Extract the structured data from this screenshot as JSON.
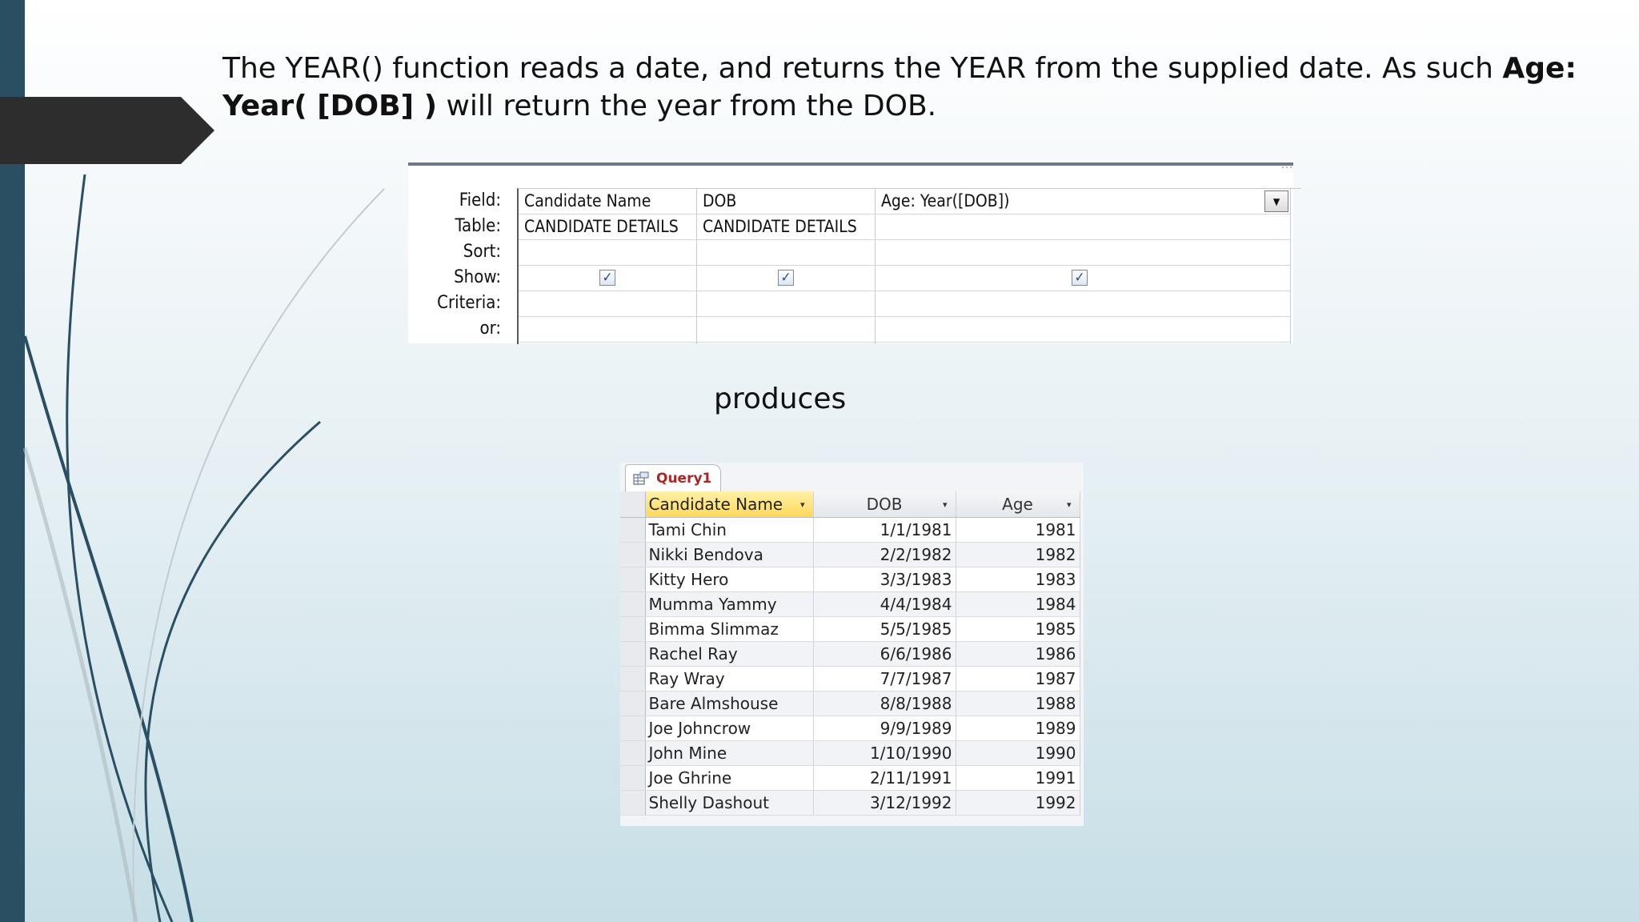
{
  "slide": {
    "intro_plain": "The YEAR() function reads a date, and returns the YEAR from the supplied date. As such ",
    "intro_bold": "Age: Year( [DOB] )",
    "intro_tail": " will return the year from the DOB.",
    "produces": "produces"
  },
  "qbe": {
    "row_labels": [
      "Field:",
      "Table:",
      "Sort:",
      "Show:",
      "Criteria:",
      "or:"
    ],
    "columns": [
      {
        "field": "Candidate Name",
        "table": "CANDIDATE DETAILS",
        "sort": "",
        "show": true
      },
      {
        "field": "DOB",
        "table": "CANDIDATE DETAILS",
        "sort": "",
        "show": true
      },
      {
        "field": "Age: Year([DOB])",
        "table": "",
        "sort": "",
        "show": true
      }
    ],
    "dots": "...",
    "checkmark": "✓",
    "dropdown_glyph": "▼"
  },
  "datasheet": {
    "tab_label": "Query1",
    "headers": [
      "Candidate Name",
      "DOB",
      "Age"
    ],
    "sort_glyph": "▾",
    "rows": [
      {
        "name": "Tami Chin",
        "dob": "1/1/1981",
        "age": "1981"
      },
      {
        "name": "Nikki Bendova",
        "dob": "2/2/1982",
        "age": "1982"
      },
      {
        "name": "Kitty Hero",
        "dob": "3/3/1983",
        "age": "1983"
      },
      {
        "name": "Mumma Yammy",
        "dob": "4/4/1984",
        "age": "1984"
      },
      {
        "name": "Bimma Slimmaz",
        "dob": "5/5/1985",
        "age": "1985"
      },
      {
        "name": "Rachel Ray",
        "dob": "6/6/1986",
        "age": "1986"
      },
      {
        "name": "Ray Wray",
        "dob": "7/7/1987",
        "age": "1987"
      },
      {
        "name": "Bare Almshouse",
        "dob": "8/8/1988",
        "age": "1988"
      },
      {
        "name": "Joe Johncrow",
        "dob": "9/9/1989",
        "age": "1989"
      },
      {
        "name": "John Mine",
        "dob": "1/10/1990",
        "age": "1990"
      },
      {
        "name": "Joe Ghrine",
        "dob": "2/11/1991",
        "age": "1991"
      },
      {
        "name": "Shelly Dashout",
        "dob": "3/12/1992",
        "age": "1992"
      }
    ]
  },
  "colors": {
    "accent_dark": "#2a4f63",
    "tab_text": "#a82828",
    "selected_header": "#ffd85a"
  }
}
